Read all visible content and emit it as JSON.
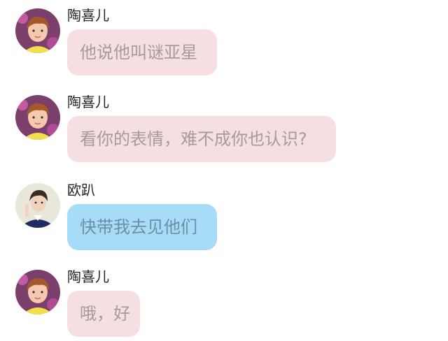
{
  "messages": [
    {
      "sender": "陶喜儿",
      "text": "他说他叫谜亚星",
      "avatar": "girl-avatar",
      "bubble_color": "#f6dfe0"
    },
    {
      "sender": "陶喜儿",
      "text": "看你的表情，难不成你也认识?",
      "avatar": "girl-avatar",
      "bubble_color": "#f6dfe0"
    },
    {
      "sender": "欧趴",
      "text": "快带我去见他们",
      "avatar": "boy-avatar",
      "bubble_color": "#a7dcf8"
    },
    {
      "sender": "陶喜儿",
      "text": "哦，好",
      "avatar": "girl-avatar",
      "bubble_color": "#f6dfe0"
    }
  ]
}
